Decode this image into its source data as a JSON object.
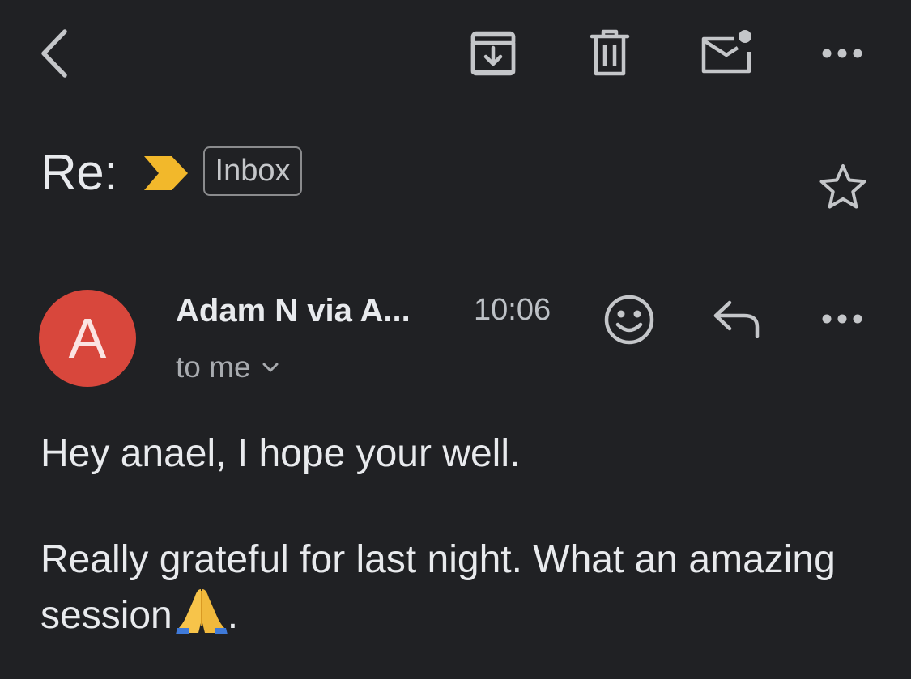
{
  "toolbar": {
    "back_icon": "chevron-left-icon",
    "archive_icon": "archive-icon",
    "delete_icon": "trash-icon",
    "mark_unread_icon": "mail-unread-icon",
    "more_icon": "more-horizontal-icon"
  },
  "subject": {
    "text": "Re:",
    "importance_color": "#F2B82B",
    "label": "Inbox",
    "star_icon": "star-outline-icon"
  },
  "message": {
    "avatar_letter": "A",
    "avatar_color": "#D8473C",
    "sender": "Adam N via A...",
    "time": "10:06",
    "recipient": "to me",
    "emoji_react_icon": "smiley-icon",
    "reply_icon": "reply-icon",
    "more_icon": "more-horizontal-icon",
    "paragraphs": [
      "Hey anael, I hope your well.",
      "Really grateful for last night. What an amazing session"
    ],
    "trailing": "."
  }
}
